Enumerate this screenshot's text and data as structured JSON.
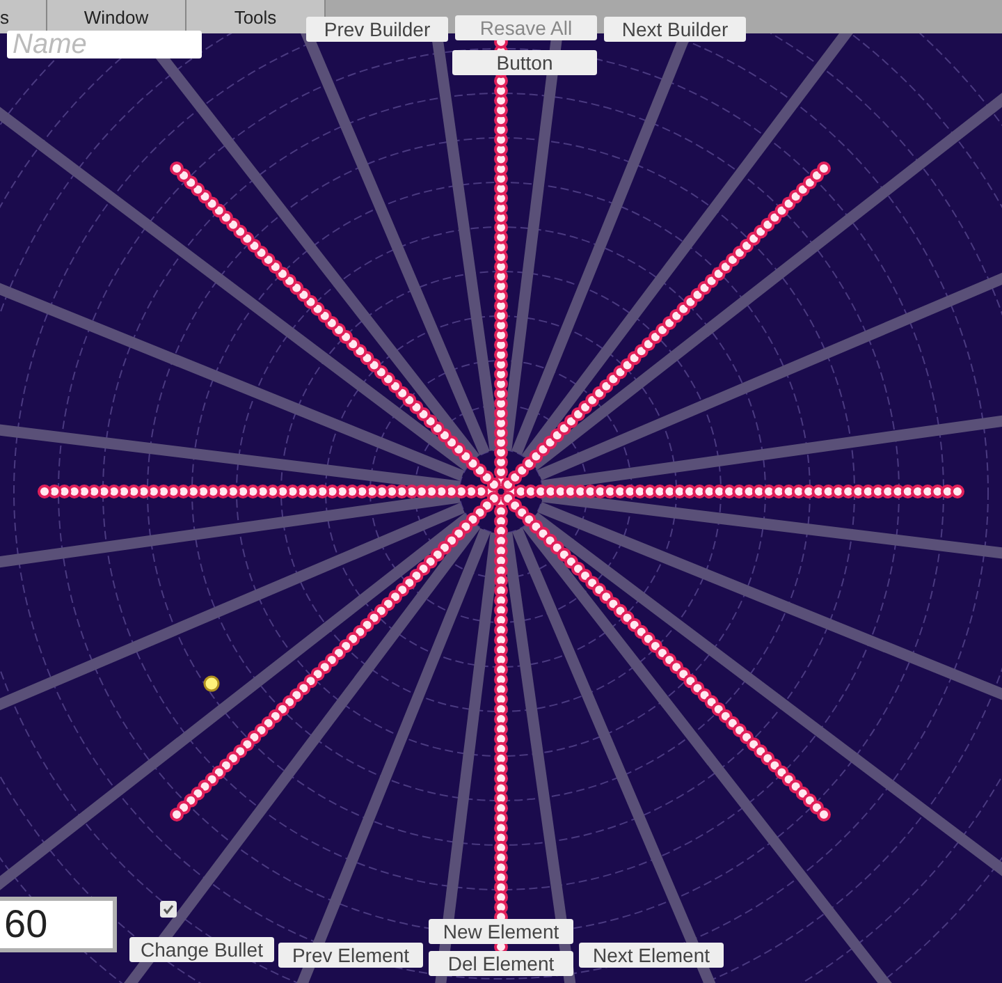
{
  "menu_bar": {
    "items": [
      {
        "label": "s"
      },
      {
        "label": "Window"
      },
      {
        "label": "Tools"
      }
    ]
  },
  "name_field": {
    "placeholder": "Name"
  },
  "top_buttons": [
    {
      "label": "Prev Builder"
    },
    {
      "label": "Resave All"
    },
    {
      "label": "Next Builder"
    }
  ],
  "center_button": {
    "label": "Button"
  },
  "angle_field": {
    "value": "60"
  },
  "checkbox": {
    "checked": true
  },
  "bottom_buttons": [
    {
      "label": "Change Bullet"
    },
    {
      "label": "Prev Element"
    },
    {
      "label": "New Element"
    },
    {
      "label": "Del Element"
    },
    {
      "label": "Next Element"
    }
  ]
}
